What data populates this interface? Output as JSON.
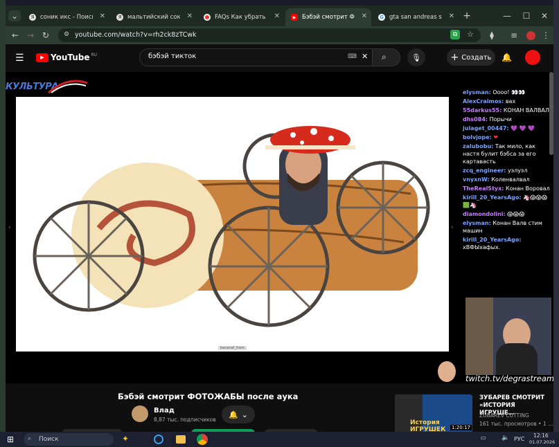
{
  "tabs": [
    {
      "title": "соник икс - Поиск в Goo",
      "icon": "yandex-icon",
      "color": "#e8e8e8"
    },
    {
      "title": "мальтийский сокол фи",
      "icon": "yandex-icon",
      "color": "#e8e8e8"
    },
    {
      "title": "FAQs Как убрать шумы",
      "icon": "record-icon",
      "color": "#e33"
    },
    {
      "title": "Бэбэй смотрит ФОТОЖ",
      "icon": "youtube-icon",
      "color": "#f00"
    },
    {
      "title": "gta san andreas stories",
      "icon": "google-icon",
      "color": "#4285f4"
    }
  ],
  "browser": {
    "url": "youtube.com/watch?v=rh2ck8zTCwk",
    "new_tab": "+",
    "minimize": "—",
    "maximize": "☐",
    "close": "✕"
  },
  "youtube": {
    "logo_text": "YouTube",
    "region": "RU",
    "search_value": "бэбэй тикток",
    "create_label": "Создать"
  },
  "stream": {
    "channel_logo": "КУЛЬТУРА",
    "watermark": "twitch.tv/degrastream",
    "caption_small": "bananaf_fram"
  },
  "chat": [
    {
      "user": "elysman:",
      "text": "Оооо! 👀👀",
      "color": "#7aa3ff"
    },
    {
      "user": "AlexCraimos:",
      "text": "вах",
      "color": "#7aa3ff"
    },
    {
      "user": "55darkus55:",
      "text": "КОНАН ВАЛВАЛ",
      "color": "#c77dff"
    },
    {
      "user": "dhs084:",
      "text": "Порычи",
      "color": "#c77dff"
    },
    {
      "user": "julaget_00447:",
      "text": "💜 💜 💜",
      "color": "#7aa3ff"
    },
    {
      "user": "bolvjope:",
      "text": "❤",
      "color": "#7aa3ff"
    },
    {
      "user": "zalubobu:",
      "text": "Так мило, как настя булит бэбса за его картавасть",
      "color": "#7aa3ff"
    },
    {
      "user": "zcq_engineer:",
      "text": "уэлуэл",
      "color": "#7aa3ff"
    },
    {
      "user": "vnyxnW:",
      "text": "Коленвалвал",
      "color": "#7aa3ff"
    },
    {
      "user": "TheRealStyx:",
      "text": "Конан Воровал",
      "color": "#c77dff"
    },
    {
      "user": "kirill_20_YearsAgo:",
      "text": "🦄😱😱😱🟩🦄",
      "color": "#7aa3ff"
    },
    {
      "user": "diamondolini:",
      "text": "😱😱😱",
      "color": "#c77dff"
    },
    {
      "user": "elysman:",
      "text": "Конан Валв стим машин",
      "color": "#7aa3ff"
    },
    {
      "user": "kirill_20_YearsAgo:",
      "text": "хВФЫхафых.",
      "color": "#7aa3ff"
    }
  ],
  "video": {
    "title": "Бэбэй смотрит ФОТОЖАБЫ после аука",
    "channel": "Влад",
    "subscribers": "8,87 тыс. подписчиков"
  },
  "recommended": {
    "title": "ЗУБАРЕВ СМОТРИТ «ИСТОРИЯ ИГРУШЕ…",
    "channel": "ZUBAREV CUTTING",
    "meta": "161 тыс. просмотров • 1 …",
    "thumb_text": "История ИГРУШЕК",
    "duration": "1:20:17"
  },
  "taskbar": {
    "search_label": "Поиск",
    "lang": "РУС",
    "time": "12:16",
    "date": "01.07.2026"
  }
}
